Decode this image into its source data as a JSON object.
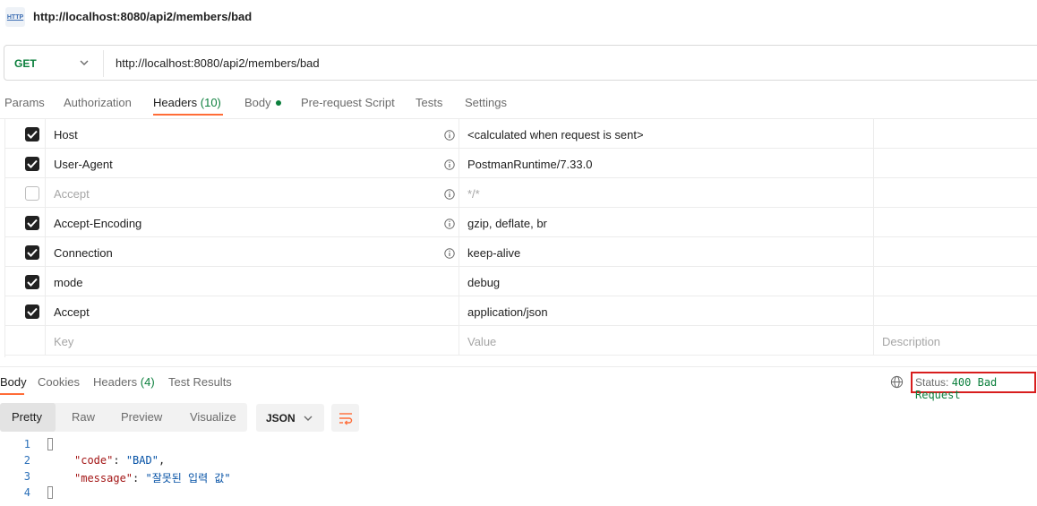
{
  "tab_title": "http://localhost:8080/api2/members/bad",
  "request": {
    "method": "GET",
    "url": "http://localhost:8080/api2/members/bad"
  },
  "request_tabs": {
    "params": "Params",
    "authorization": "Authorization",
    "headers_label": "Headers",
    "headers_count": "(10)",
    "body": "Body",
    "prerequest": "Pre-request Script",
    "tests": "Tests",
    "settings": "Settings"
  },
  "headers": [
    {
      "enabled": true,
      "key": "Host",
      "value": "<calculated when request is sent>",
      "auto": true
    },
    {
      "enabled": true,
      "key": "User-Agent",
      "value": "PostmanRuntime/7.33.0",
      "auto": true
    },
    {
      "enabled": false,
      "key": "Accept",
      "value": "*/*",
      "auto": true
    },
    {
      "enabled": true,
      "key": "Accept-Encoding",
      "value": "gzip, deflate, br",
      "auto": true
    },
    {
      "enabled": true,
      "key": "Connection",
      "value": "keep-alive",
      "auto": true
    },
    {
      "enabled": true,
      "key": "mode",
      "value": "debug",
      "auto": false
    },
    {
      "enabled": true,
      "key": "Accept",
      "value": "application/json",
      "auto": false
    }
  ],
  "new_row": {
    "key": "Key",
    "value": "Value",
    "description": "Description"
  },
  "response_tabs": {
    "body": "Body",
    "cookies": "Cookies",
    "headers_label": "Headers",
    "headers_count": "(4)",
    "test_results": "Test Results"
  },
  "status": {
    "label": "Status:",
    "code": "400 Bad Request"
  },
  "view_modes": {
    "pretty": "Pretty",
    "raw": "Raw",
    "preview": "Preview",
    "visualize": "Visualize",
    "selected": "Pretty"
  },
  "format": "JSON",
  "response_body": {
    "line_numbers": [
      "1",
      "2",
      "3",
      "4"
    ],
    "code_key": "\"code\"",
    "code_value": "\"BAD\"",
    "message_key": "\"message\"",
    "message_value": "\"잘못된 입력 값\""
  },
  "colors": {
    "accent": "#ff6c37",
    "success": "#0b7f3c",
    "status_highlight": "#d81e1e"
  }
}
